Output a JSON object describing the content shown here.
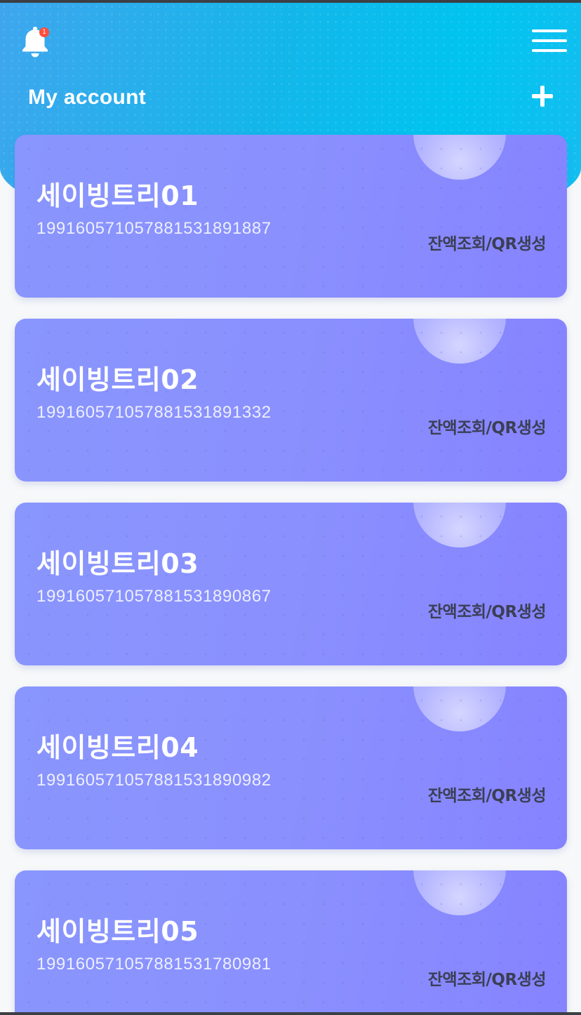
{
  "header": {
    "title": "My account",
    "notification_count": "1",
    "notification_icon": "bell-icon",
    "menu_icon": "hamburger-menu-icon",
    "add_icon": "plus-icon"
  },
  "accounts": [
    {
      "name": "세이빙트리01",
      "number": "19916057105788153189188​7",
      "action": "잔액조회/QR생성"
    },
    {
      "name": "세이빙트리02",
      "number": "1991605710578815318913​32",
      "action": "잔액조회/QR생성"
    },
    {
      "name": "세이빙트리03",
      "number": "1991605710578815318908​67",
      "action": "잔액조회/QR생성"
    },
    {
      "name": "세이빙트리04",
      "number": "1991605710578815318909​82",
      "action": "잔액조회/QR생성"
    },
    {
      "name": "세이빙트리05",
      "number": "1991605710578815317809​81",
      "action": "잔액조회/QR생성"
    }
  ],
  "colors": {
    "header_start": "#3fa6ee",
    "header_end": "#00c4ef",
    "card": "#8a90fe",
    "action_text": "#3b3f55"
  }
}
